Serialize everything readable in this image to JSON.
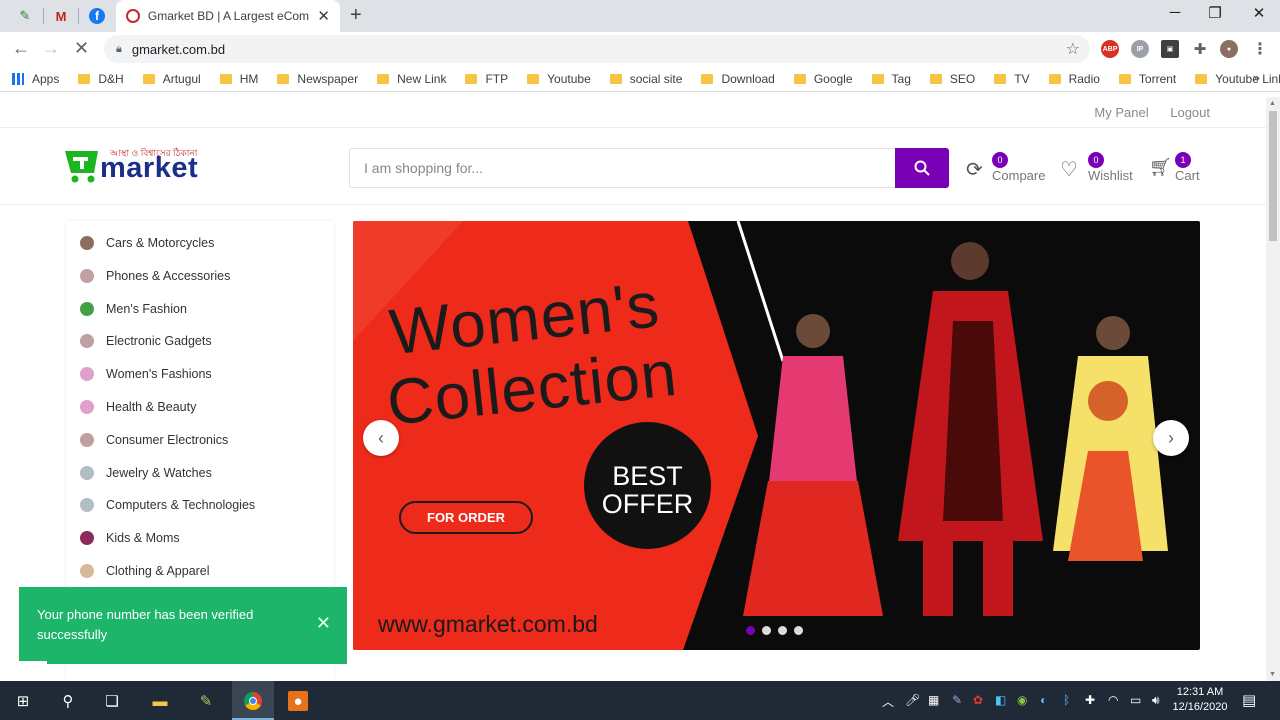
{
  "browser": {
    "active_tab_title": "Gmarket BD | A Largest eCommerce",
    "url": "gmarket.com.bd",
    "bookmarks": [
      "Apps",
      "D&H",
      "Artugul",
      "HM",
      "Newspaper",
      "New Link",
      "FTP",
      "Youtube",
      "social site",
      "Download",
      "Google",
      "Tag",
      "SEO",
      "TV",
      "Radio",
      "Torrent",
      "Youtube Link"
    ],
    "icons": [
      "back-icon",
      "forward-icon",
      "stop-icon",
      "lock-icon",
      "star-icon",
      "extensions-icon",
      "menu-icon"
    ]
  },
  "topbar": {
    "my_panel": "My Panel",
    "logout": "Logout"
  },
  "header": {
    "logo_tagline": "আস্থা ও বিশ্বাসের ঠিকানা",
    "logo_text": "market",
    "search_placeholder": "I am shopping for...",
    "compare": {
      "label": "Compare",
      "count": "0"
    },
    "wishlist": {
      "label": "Wishlist",
      "count": "0"
    },
    "cart": {
      "label": "Cart",
      "count": "1"
    }
  },
  "categories": [
    "Cars & Motorcycles",
    "Phones & Accessories",
    "Men's Fashion",
    "Electronic Gadgets",
    "Women's Fashions",
    "Health & Beauty",
    "Consumer Electronics",
    "Jewelry & Watches",
    "Computers & Technologies",
    "Kids & Moms",
    "Clothing & Apparel"
  ],
  "banner": {
    "title_line1": "Women's",
    "title_line2": "Collection",
    "order_button": "FOR ORDER",
    "offer_line1": "BEST",
    "offer_line2": "OFFER",
    "website": "www.gmarket.com.bd",
    "slide_count": 4,
    "active_slide": 1,
    "colors": {
      "red": "#ee2a1b",
      "black": "#0b0b0b"
    }
  },
  "toast": {
    "message": "Your phone number has been verified successfully"
  },
  "colors": {
    "accent": "#7a00b6",
    "toast": "#1db56a",
    "logo_green": "#1bb520",
    "logo_blue": "#1b2f8a"
  },
  "taskbar": {
    "time": "12:31 AM",
    "date": "12/16/2020"
  }
}
